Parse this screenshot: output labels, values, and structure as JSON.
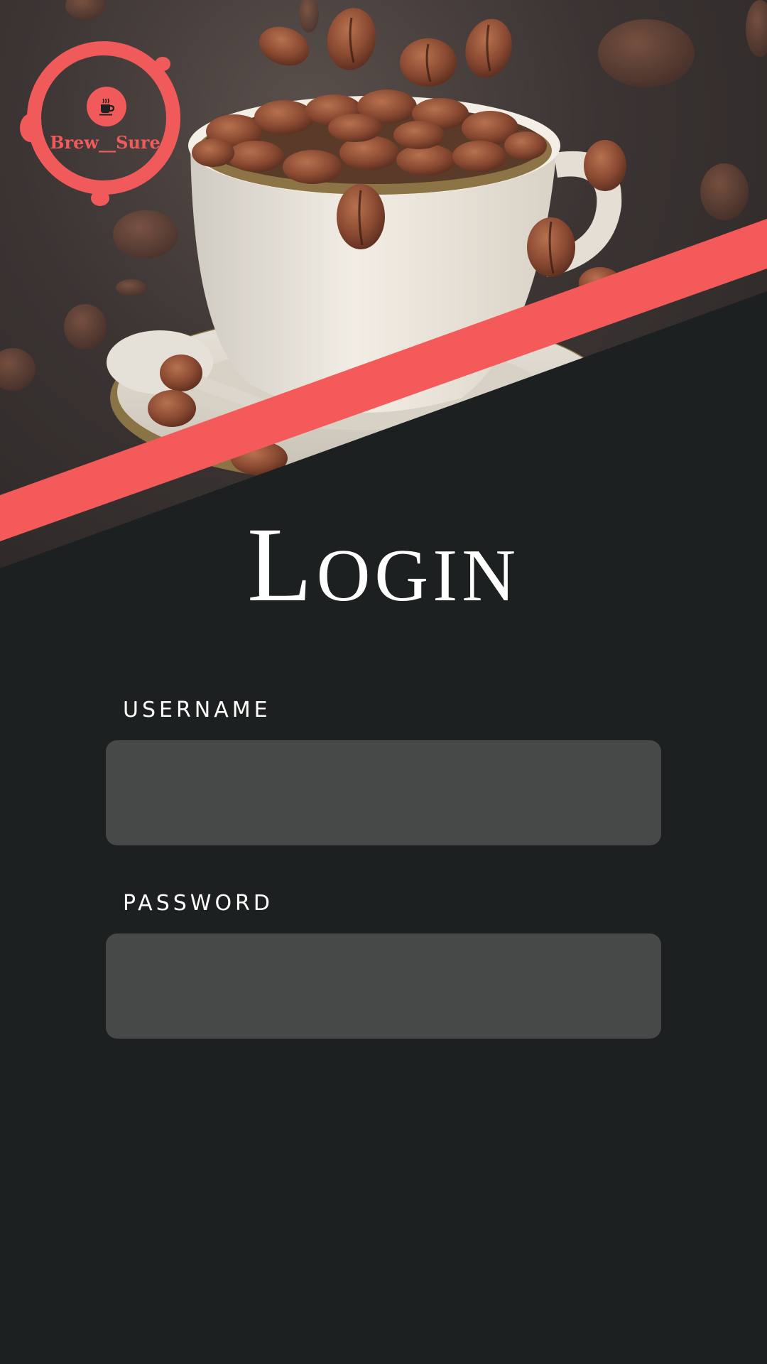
{
  "brand": {
    "name": "Brew__Sure",
    "accent_color": "#f05a5a",
    "logo_icon": "coffee-cup-icon"
  },
  "hero": {
    "image": "coffee-cup-with-beans-photo"
  },
  "login": {
    "title": "Login",
    "username_label": "USERNAME",
    "username_value": "",
    "password_label": "PASSWORD",
    "password_value": ""
  },
  "colors": {
    "background": "#1d2020",
    "field_background": "#474948",
    "text": "#ffffff"
  }
}
